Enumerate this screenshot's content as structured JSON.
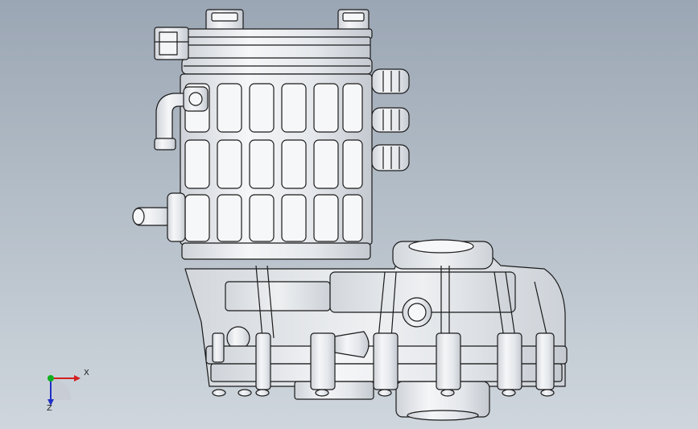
{
  "viewport": {
    "background_top": "#9ba6b4",
    "background_bottom": "#cfd6dd",
    "model_fill": "#e6e8ec",
    "model_fill_light": "#f4f5f7",
    "model_line": "#1a1a1a"
  },
  "triad": {
    "x_label": "X",
    "z_label": "Z",
    "x_color": "#d42020",
    "y_color": "#10b020",
    "z_color": "#2030c8"
  }
}
